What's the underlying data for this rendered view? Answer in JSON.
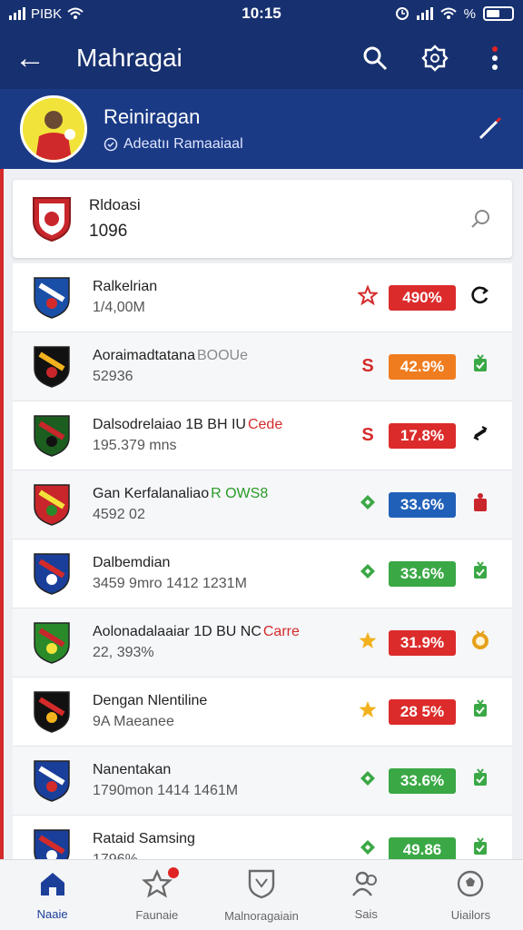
{
  "status": {
    "carrier": "PIBK",
    "time": "10:15",
    "battery_symbol": "%"
  },
  "header": {
    "title": "Mahragai"
  },
  "profile": {
    "name": "Reiniragan",
    "subtitle": "Adeatıı Ramaaiaal"
  },
  "featured": {
    "name": "Rldoasi",
    "value": "1096"
  },
  "colors": {
    "red": "#dc2b2b",
    "orange": "#ef7d1f",
    "blue": "#2160b8",
    "green": "#3aa845",
    "navy": "#17306f",
    "accent_blue": "#1c3f9a"
  },
  "rows": [
    {
      "name": "Ralkelrian",
      "accent": "",
      "sub": "1/4,00M",
      "subaccent": "",
      "icon1": "star-outline-icon",
      "pct": "490%",
      "pct_color": "red",
      "icon2": "refresh-icon"
    },
    {
      "name": "Aoraimadtatana",
      "accent": "BOOUe",
      "sub": "52936",
      "subaccent": "",
      "icon1": "s-badge-icon",
      "pct": "42.9%",
      "pct_color": "orange",
      "icon2": "green-trophy-icon"
    },
    {
      "name": "Dalsodrelaiao 1B BH IU",
      "accent": "Cede",
      "sub": "195.379 mns",
      "subaccent": "",
      "icon1": "s-badge-icon",
      "pct": "17.8%",
      "pct_color": "red",
      "icon2": "swap-icon"
    },
    {
      "name": "Gan Kerfalanaliao",
      "accent": "R OWS8",
      "sub": "4592 02",
      "subaccent": "",
      "icon1": "green-diamond-icon",
      "pct": "33.6%",
      "pct_color": "blue",
      "icon2": "red-figure-icon"
    },
    {
      "name": "Dalbemdian",
      "accent": "",
      "sub": "3459 9mro 1412 1231M",
      "subaccent": "",
      "icon1": "green-diamond-icon",
      "pct": "33.6%",
      "pct_color": "green",
      "icon2": "green-trophy-icon"
    },
    {
      "name": "Aolonadalaaiar 1D BU NC",
      "accent": "Carre",
      "sub": "22, 393%",
      "subaccent": "",
      "icon1": "gold-star-icon",
      "pct": "31.9%",
      "pct_color": "red",
      "icon2": "medal-icon"
    },
    {
      "name": "Dengan Nlentiline",
      "accent": "",
      "sub": "9A Maeanee",
      "subaccent": "",
      "icon1": "gold-star-icon",
      "pct": "28 5%",
      "pct_color": "red",
      "icon2": "green-trophy-icon"
    },
    {
      "name": "Nanentakan",
      "accent": "",
      "sub": "1790mon 1414 1461M",
      "subaccent": "",
      "icon1": "green-diamond-icon",
      "pct": "33.6%",
      "pct_color": "green",
      "icon2": "green-trophy-icon"
    },
    {
      "name": "Rataid Samsing",
      "accent": "",
      "sub": "1796%",
      "subaccent": "",
      "icon1": "green-diamond-icon",
      "pct": "49.86",
      "pct_color": "green",
      "icon2": "green-trophy-icon"
    }
  ],
  "nav": [
    {
      "label": "Naaie",
      "icon": "home-icon",
      "active": true
    },
    {
      "label": "Faunaie",
      "icon": "favorites-star-icon",
      "active": false,
      "badge": true
    },
    {
      "label": "Malnoragaiain",
      "icon": "shield-icon",
      "active": false
    },
    {
      "label": "Sais",
      "icon": "people-icon",
      "active": false
    },
    {
      "label": "Uiailors",
      "icon": "soccer-ball-icon",
      "active": false
    }
  ]
}
